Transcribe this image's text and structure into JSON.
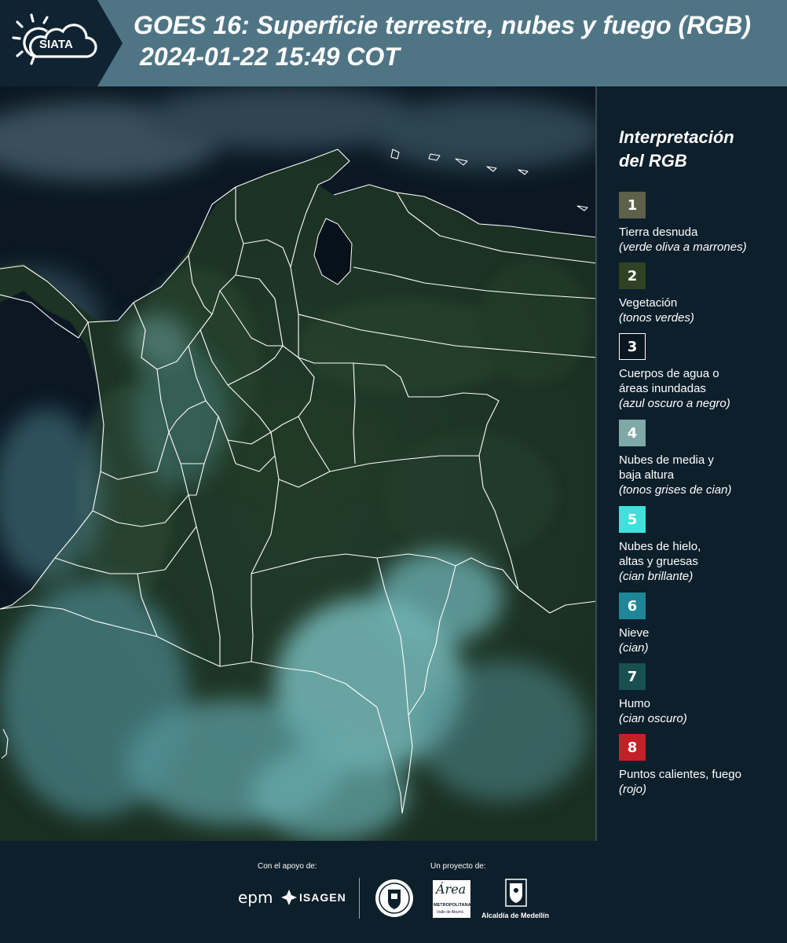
{
  "header": {
    "logo_text": "SIATA",
    "title_line1": "GOES 16: Superficie terrestre, nubes y fuego (RGB)",
    "title_line2": "2024-01-22 15:49 COT",
    "colors": {
      "left_panel": "#0f2332",
      "title_band": "#4f7585"
    }
  },
  "map": {
    "description_colors": {
      "land": "#1c3426",
      "ocean": "#0a1522",
      "cloud": "#7fd0d0",
      "border": "#ffffff"
    }
  },
  "legend": {
    "title_line1": "Interpretación",
    "title_line2": "del RGB",
    "items": [
      {
        "num": "1",
        "color": "#5e6149",
        "text_color": "#ffffff",
        "label_lines": [
          "Tierra desnuda"
        ],
        "sub": "(verde oliva a marrones)"
      },
      {
        "num": "2",
        "color": "#2f4224",
        "text_color": "#ffffff",
        "label_lines": [
          "Vegetación"
        ],
        "sub": "(tonos verdes)"
      },
      {
        "num": "3",
        "color": "#0a1620",
        "text_color": "#ffffff",
        "label_lines": [
          "Cuerpos de agua o",
          "áreas inundadas"
        ],
        "sub": "(azul oscuro a negro)"
      },
      {
        "num": "4",
        "color": "#7fa9a6",
        "text_color": "#ffffff",
        "label_lines": [
          "Nubes de media y",
          "baja altura"
        ],
        "sub": "(tonos grises de cian)"
      },
      {
        "num": "5",
        "color": "#3fe1dc",
        "text_color": "#ffffff",
        "label_lines": [
          "Nubes de hielo,",
          "altas y gruesas"
        ],
        "sub": "(cian brillante)"
      },
      {
        "num": "6",
        "color": "#1e8797",
        "text_color": "#ffffff",
        "label_lines": [
          "Nieve"
        ],
        "sub": "(cian)"
      },
      {
        "num": "7",
        "color": "#17504f",
        "text_color": "#ffffff",
        "label_lines": [
          "Humo"
        ],
        "sub": "(cian oscuro)"
      },
      {
        "num": "8",
        "color": "#c42127",
        "text_color": "#ffffff",
        "label_lines": [
          "Puntos calientes, fuego"
        ],
        "sub": "(rojo)"
      }
    ]
  },
  "footer": {
    "support_label": "Con el apoyo de:",
    "project_label": "Un proyecto de:",
    "epm": "epm",
    "isagen": "ISAGEN",
    "area_metro": "Área",
    "area_metro_sub": "METROPOLITANA",
    "area_metro_sub2": "Valle de Aburrá",
    "alcaldia": "Alcaldía de Medellín"
  }
}
